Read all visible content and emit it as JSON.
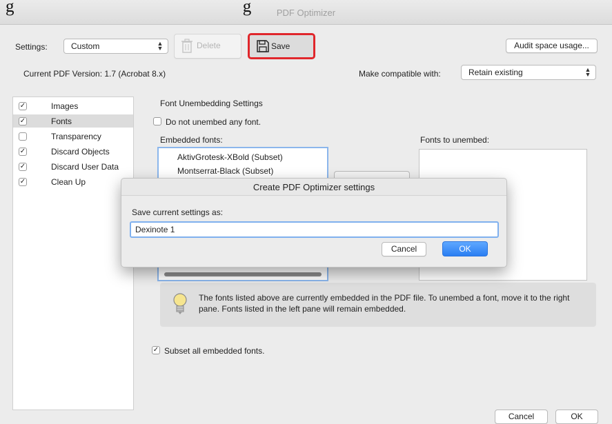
{
  "window": {
    "title": "PDF Optimizer"
  },
  "overlay_caption": "g                                                     g",
  "toolbar": {
    "settings_label": "Settings:",
    "settings_value": "Custom",
    "delete_label": "Delete",
    "save_label": "Save",
    "audit_label": "Audit space usage...",
    "highlight_color": "#e0262b"
  },
  "version": {
    "current_label": "Current PDF Version: 1.7 (Acrobat 8.x)",
    "compat_label": "Make compatible with:",
    "compat_value": "Retain existing"
  },
  "categories": [
    {
      "label": "Images",
      "checked": true
    },
    {
      "label": "Fonts",
      "checked": true,
      "selected": true
    },
    {
      "label": "Transparency",
      "checked": false
    },
    {
      "label": "Discard Objects",
      "checked": true
    },
    {
      "label": "Discard User Data",
      "checked": true
    },
    {
      "label": "Clean Up",
      "checked": true
    }
  ],
  "fonts_panel": {
    "section_title": "Font Unembedding Settings",
    "do_not_unembed_label": "Do not unembed any font.",
    "embedded_label": "Embedded fonts:",
    "unembed_label": "Fonts to unembed:",
    "embedded_fonts": [
      "AktivGrotesk-XBold (Subset)",
      "Montserrat-Black (Subset)"
    ],
    "info_text": "The fonts listed above are currently embedded in the PDF file. To unembed a font, move it to the right pane. Fonts listed in the left pane will remain embedded.",
    "subset_label": "Subset all embedded fonts."
  },
  "dialog": {
    "title": "Create PDF Optimizer settings",
    "prompt": "Save current settings as:",
    "value": "Dexinote 1",
    "cancel_label": "Cancel",
    "ok_label": "OK"
  },
  "footer": {
    "cancel_label": "Cancel",
    "ok_label": "OK"
  }
}
